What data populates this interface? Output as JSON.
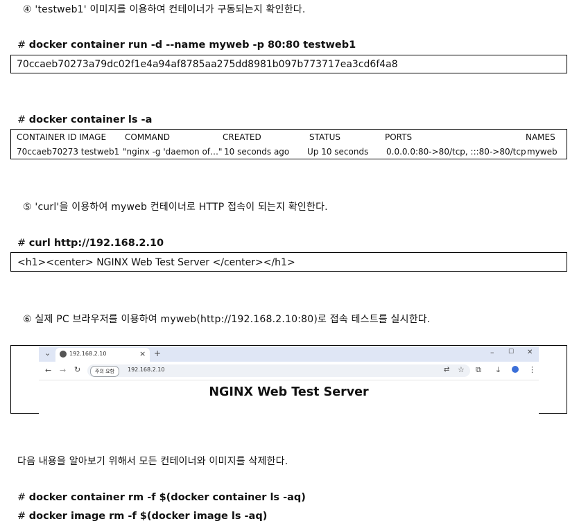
{
  "step4": {
    "text": "④ 'testweb1' 이미지를 이용하여 컨테이너가 구동되는지 확인한다."
  },
  "cmd_run": {
    "hash": "#",
    "command": "docker container run -d --name myweb -p 80:80 testweb1"
  },
  "run_output": "70ccaeb70273a79dc02f1e4a94af8785aa275dd8981b097b773717ea3cd6f4a8",
  "cmd_ls": {
    "hash": "#",
    "command": "docker container ls -a"
  },
  "ls_table": {
    "headers": [
      "CONTAINER ID IMAGE",
      "COMMAND",
      "CREATED",
      "STATUS",
      "PORTS",
      "NAMES"
    ],
    "row": [
      "70ccaeb70273 testweb1",
      "\"nginx -g 'daemon of…\"",
      "10 seconds ago",
      "Up 10 seconds",
      "0.0.0.0:80->80/tcp, :::80->80/tcp",
      "myweb"
    ]
  },
  "step5": {
    "text": "⑤ 'curl'을 이용하여 myweb 컨테이너로 HTTP 접속이 되는지 확인한다."
  },
  "cmd_curl": {
    "hash": "#",
    "command": "curl http://192.168.2.10"
  },
  "curl_output": "<h1><center> NGINX Web Test Server </center></h1>",
  "step6": {
    "text": "⑥ 실제 PC 브라우저를 이용하여 myweb(http://192.168.2.10:80)로 접속 테스트를 실시한다."
  },
  "browser": {
    "tab_title": "192.168.2.10",
    "tab_close": "×",
    "new_tab": "+",
    "url": "192.168.2.10",
    "security_chip": "주의 요함",
    "page_heading": "NGINX Web Test Server",
    "window_controls": [
      "–",
      "☐",
      "✕"
    ],
    "nav_icons": [
      "arrow-left-icon",
      "arrow-right-icon",
      "reload-icon"
    ],
    "toolbar_icons": [
      "translate-icon",
      "star-icon",
      "extensions-icon",
      "download-icon",
      "profile-icon",
      "menu-icon"
    ]
  },
  "note": {
    "text": "다음 내용을 알아보기 위해서 모든 컨테이너와 이미지를 삭제한다."
  },
  "cmd_rm_containers": {
    "hash": "#",
    "command": "docker container rm -f $(docker container ls -aq)"
  },
  "cmd_rm_images": {
    "hash": "#",
    "command": "docker image rm -f $(docker image ls -aq)"
  }
}
